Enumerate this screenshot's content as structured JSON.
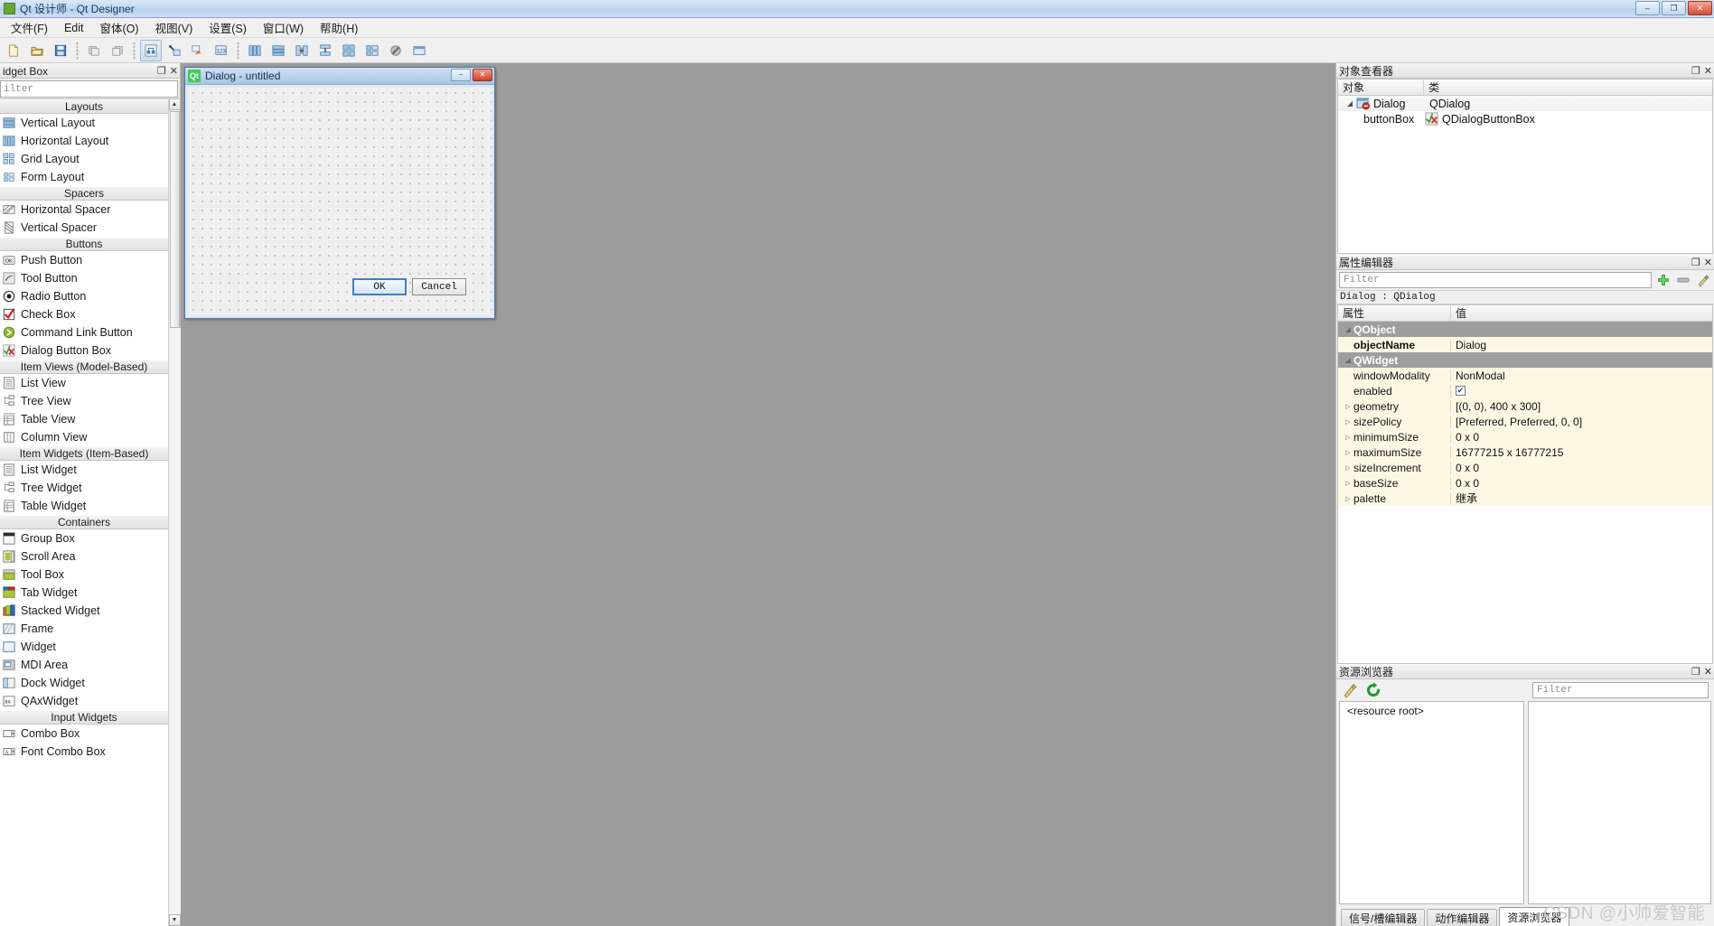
{
  "window": {
    "title": "Qt 设计师 - Qt Designer",
    "app_icon": "qt-logo-icon",
    "minimize_label": "–",
    "maximize_label": "❐",
    "close_label": "✕"
  },
  "menubar": {
    "items": [
      {
        "label": "文件(F)",
        "name": "menu-file"
      },
      {
        "label": "Edit",
        "name": "menu-edit"
      },
      {
        "label": "窗体(O)",
        "name": "menu-form"
      },
      {
        "label": "视图(V)",
        "name": "menu-view"
      },
      {
        "label": "设置(S)",
        "name": "menu-settings"
      },
      {
        "label": "窗口(W)",
        "name": "menu-window"
      },
      {
        "label": "帮助(H)",
        "name": "menu-help"
      }
    ]
  },
  "toolbar": {
    "groups": [
      [
        "new-form-icon",
        "open-form-icon",
        "save-form-icon"
      ],
      [
        "undo-icon",
        "redo-icon"
      ],
      [
        "edit-widgets-icon",
        "edit-signals-slots-icon",
        "edit-buddies-icon",
        "edit-tab-order-icon"
      ],
      [
        "layout-horizontally-icon",
        "layout-vertically-icon",
        "layout-horizontal-splitter-icon",
        "layout-vertical-splitter-icon",
        "layout-grid-icon",
        "layout-form-icon",
        "break-layout-icon",
        "adjust-size-icon"
      ]
    ]
  },
  "widget_box": {
    "title": "idget Box",
    "filter_placeholder": "ilter",
    "float_btn": "❐",
    "close_btn": "✕",
    "scroll_up": "▲",
    "scroll_down": "▼",
    "groups": [
      {
        "name": "Layouts",
        "items": [
          {
            "label": "Vertical Layout",
            "icon": "vertical-layout-icon"
          },
          {
            "label": "Horizontal Layout",
            "icon": "horizontal-layout-icon"
          },
          {
            "label": "Grid Layout",
            "icon": "grid-layout-icon"
          },
          {
            "label": "Form Layout",
            "icon": "form-layout-icon"
          }
        ]
      },
      {
        "name": "Spacers",
        "items": [
          {
            "label": "Horizontal Spacer",
            "icon": "horizontal-spacer-icon"
          },
          {
            "label": "Vertical Spacer",
            "icon": "vertical-spacer-icon"
          }
        ]
      },
      {
        "name": "Buttons",
        "items": [
          {
            "label": "Push Button",
            "icon": "push-button-icon"
          },
          {
            "label": "Tool Button",
            "icon": "tool-button-icon"
          },
          {
            "label": "Radio Button",
            "icon": "radio-button-icon"
          },
          {
            "label": "Check Box",
            "icon": "check-box-icon"
          },
          {
            "label": "Command Link Button",
            "icon": "command-link-button-icon"
          },
          {
            "label": "Dialog Button Box",
            "icon": "dialog-button-box-icon"
          }
        ]
      },
      {
        "name": "Item Views (Model-Based)",
        "items": [
          {
            "label": "List View",
            "icon": "list-view-icon"
          },
          {
            "label": "Tree View",
            "icon": "tree-view-icon"
          },
          {
            "label": "Table View",
            "icon": "table-view-icon"
          },
          {
            "label": "Column View",
            "icon": "column-view-icon"
          }
        ]
      },
      {
        "name": "Item Widgets (Item-Based)",
        "items": [
          {
            "label": "List Widget",
            "icon": "list-widget-icon"
          },
          {
            "label": "Tree Widget",
            "icon": "tree-widget-icon"
          },
          {
            "label": "Table Widget",
            "icon": "table-widget-icon"
          }
        ]
      },
      {
        "name": "Containers",
        "items": [
          {
            "label": "Group Box",
            "icon": "group-box-icon"
          },
          {
            "label": "Scroll Area",
            "icon": "scroll-area-icon"
          },
          {
            "label": "Tool Box",
            "icon": "tool-box-icon"
          },
          {
            "label": "Tab Widget",
            "icon": "tab-widget-icon"
          },
          {
            "label": "Stacked Widget",
            "icon": "stacked-widget-icon"
          },
          {
            "label": "Frame",
            "icon": "frame-icon"
          },
          {
            "label": "Widget",
            "icon": "widget-icon"
          },
          {
            "label": "MDI Area",
            "icon": "mdi-area-icon"
          },
          {
            "label": "Dock Widget",
            "icon": "dock-widget-icon"
          },
          {
            "label": "QAxWidget",
            "icon": "qax-widget-icon"
          }
        ]
      },
      {
        "name": "Input Widgets",
        "items": [
          {
            "label": "Combo Box",
            "icon": "combo-box-icon"
          },
          {
            "label": "Font Combo Box",
            "icon": "font-combo-box-icon"
          }
        ]
      }
    ]
  },
  "form_window": {
    "title": "Dialog - untitled",
    "qt_icon_text": "Qt",
    "minimize_label": "–",
    "close_label": "✕",
    "buttons": [
      {
        "label": "OK",
        "default": true
      },
      {
        "label": "Cancel",
        "default": false
      }
    ]
  },
  "object_inspector": {
    "title": "对象查看器",
    "float_btn": "❐",
    "close_btn": "✕",
    "columns": [
      "对象",
      "类"
    ],
    "rows": [
      {
        "expander": "◢",
        "icon": "qdialog-icon",
        "name": "Dialog",
        "class": "QDialog",
        "indent": 0
      },
      {
        "expander": "",
        "icon": "dialogbuttonbox-icon",
        "name": "buttonBox",
        "class": "QDialogButtonBox",
        "indent": 1
      }
    ]
  },
  "property_editor": {
    "title": "属性编辑器",
    "float_btn": "❐",
    "close_btn": "✕",
    "filter_placeholder": "Filter",
    "add_btn": "add-property-icon",
    "remove_btn": "remove-property-icon",
    "config_btn": "configure-icon",
    "object_line": "Dialog : QDialog",
    "columns": [
      "属性",
      "值"
    ],
    "rows": [
      {
        "type": "group",
        "key": "QObject",
        "value": "",
        "arrow": "◢"
      },
      {
        "type": "prop",
        "key": "objectName",
        "value": "Dialog",
        "bold": true,
        "shade": true
      },
      {
        "type": "group",
        "key": "QWidget",
        "value": "",
        "arrow": "◢"
      },
      {
        "type": "prop",
        "key": "windowModality",
        "value": "NonModal",
        "shade": true
      },
      {
        "type": "prop",
        "key": "enabled",
        "value": "",
        "checkbox": true,
        "checked": true,
        "shade": true
      },
      {
        "type": "prop",
        "key": "geometry",
        "value": "[(0, 0), 400 x 300]",
        "arrow": "▷",
        "shade": true
      },
      {
        "type": "prop",
        "key": "sizePolicy",
        "value": "[Preferred, Preferred, 0, 0]",
        "arrow": "▷",
        "shade": true
      },
      {
        "type": "prop",
        "key": "minimumSize",
        "value": "0 x 0",
        "arrow": "▷",
        "shade": true
      },
      {
        "type": "prop",
        "key": "maximumSize",
        "value": "16777215 x 16777215",
        "arrow": "▷",
        "shade": true
      },
      {
        "type": "prop",
        "key": "sizeIncrement",
        "value": "0 x 0",
        "arrow": "▷",
        "shade": true
      },
      {
        "type": "prop",
        "key": "baseSize",
        "value": "0 x 0",
        "arrow": "▷",
        "shade": true
      },
      {
        "type": "prop",
        "key": "palette",
        "value": "继承",
        "arrow": "▷",
        "shade": true
      }
    ]
  },
  "resource_browser": {
    "title": "资源浏览器",
    "float_btn": "❐",
    "close_btn": "✕",
    "edit_icon": "edit-resources-icon",
    "reload_icon": "reload-icon",
    "filter_placeholder": "Filter",
    "root_label": "<resource root>",
    "tabs": [
      {
        "label": "信号/槽编辑器",
        "active": false
      },
      {
        "label": "动作编辑器",
        "active": false
      },
      {
        "label": "资源浏览器",
        "active": true
      }
    ]
  },
  "watermark": {
    "text": "CSDN @小帅爱智能"
  },
  "colors": {
    "canvas_bg": "#9d9d9d",
    "chrome_bg": "#f0f0f0",
    "property_group": "#9e9e9e",
    "property_row": "#fdf7e3",
    "accent_blue": "#3f7fc1",
    "qt_green": "#41cd52"
  }
}
